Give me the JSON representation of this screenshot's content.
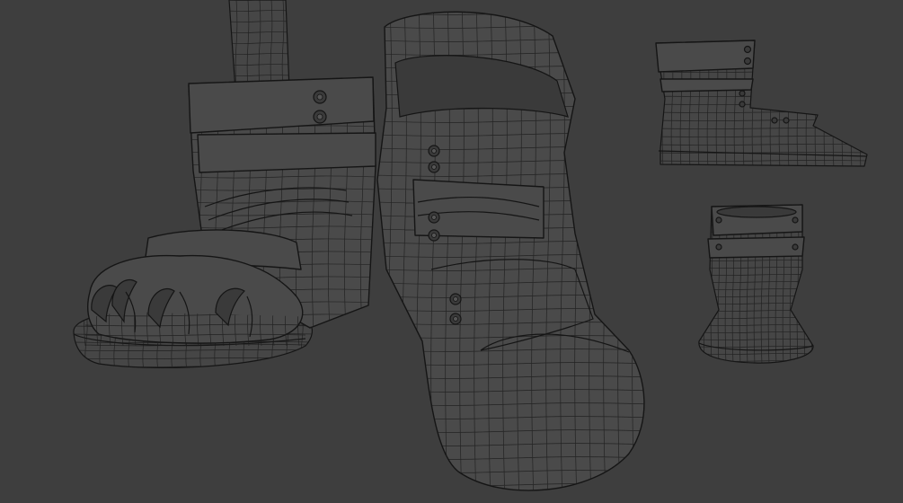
{
  "scene": {
    "type": "3d-wireframe-viewport",
    "background_color": "#3e3e3e",
    "mesh_fill_color": "#4a4a4a",
    "wire_color": "#151515",
    "objects": [
      {
        "name": "sandal-with-claws-left",
        "view": "perspective-front"
      },
      {
        "name": "boot-right",
        "view": "perspective-front"
      },
      {
        "name": "sandal-side",
        "view": "side"
      },
      {
        "name": "sandal-front",
        "view": "front"
      }
    ]
  }
}
